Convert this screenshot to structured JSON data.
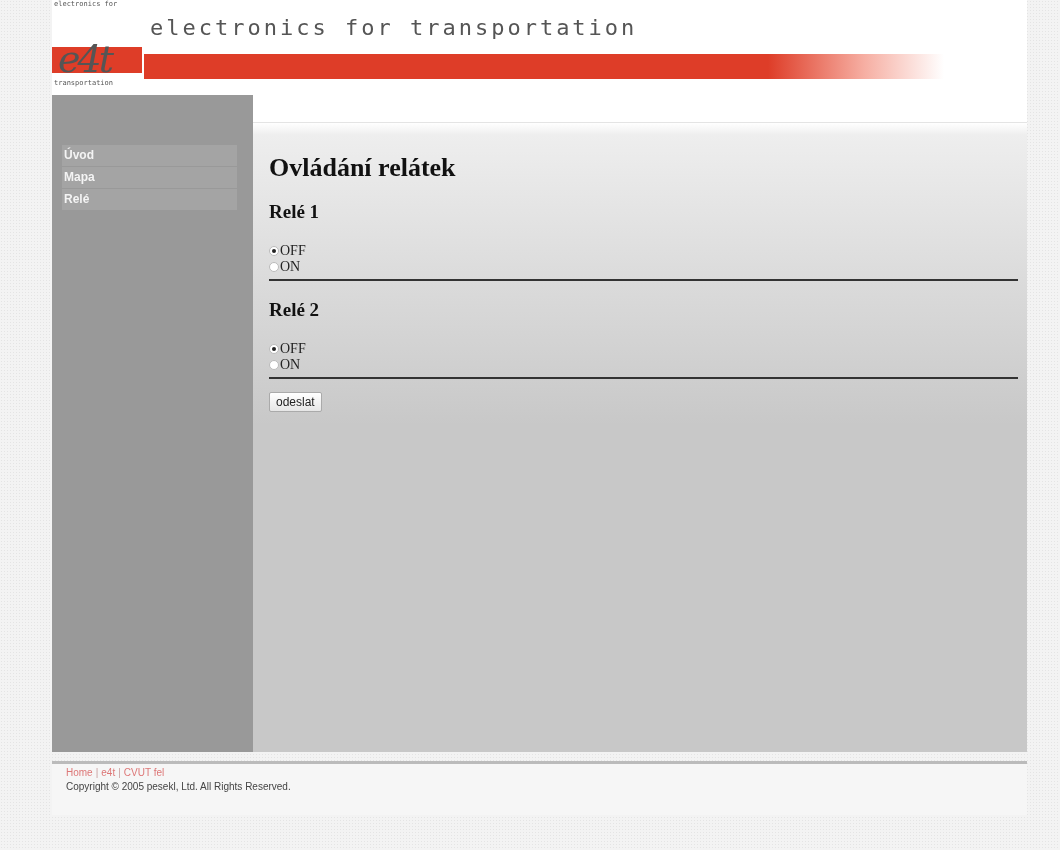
{
  "header": {
    "logo": {
      "top_text": "electronics for",
      "mark": "e4t",
      "bottom_text": "transportation"
    },
    "title": "electronics for transportation"
  },
  "sidebar": {
    "items": [
      {
        "label": "Úvod",
        "selected": false
      },
      {
        "label": "Mapa",
        "selected": false
      },
      {
        "label": "Relé",
        "selected": false
      }
    ]
  },
  "main": {
    "heading": "Ovládání relátek",
    "relays": [
      {
        "title": "Relé 1",
        "options": [
          {
            "label": "OFF",
            "selected": true
          },
          {
            "label": "ON",
            "selected": false
          }
        ]
      },
      {
        "title": "Relé 2",
        "options": [
          {
            "label": "OFF",
            "selected": true
          },
          {
            "label": "ON",
            "selected": false
          }
        ]
      }
    ],
    "submit": "odeslat"
  },
  "footer": {
    "links": [
      {
        "kind": "link",
        "text": "Home"
      },
      {
        "kind": "separator",
        "text": "|"
      },
      {
        "kind": "link",
        "text": "e4t"
      },
      {
        "kind": "separator",
        "text": "|"
      },
      {
        "kind": "link",
        "text": "CVUT fel"
      }
    ],
    "copyright": "Copyright © 2005 pesekl, Ltd. All Rights Reserved."
  }
}
